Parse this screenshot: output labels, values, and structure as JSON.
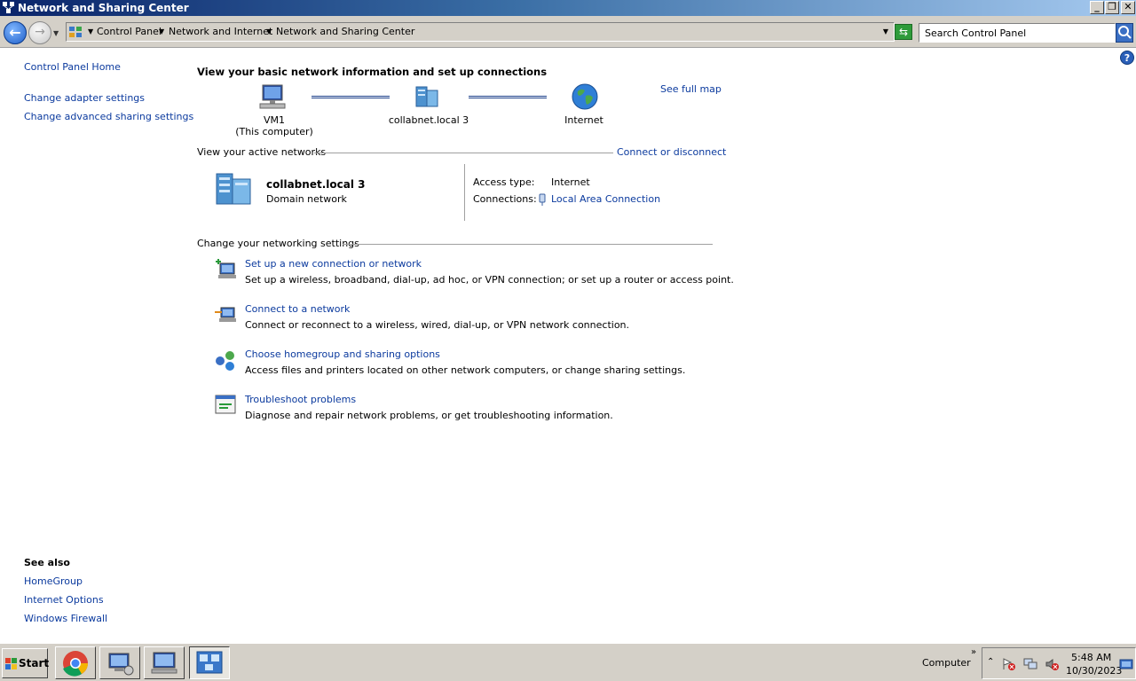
{
  "window": {
    "title": "Network and Sharing Center"
  },
  "address": {
    "crumbs": [
      "Control Panel",
      "Network and Internet",
      "Network and Sharing Center"
    ],
    "search_placeholder": "Search Control Panel"
  },
  "sidebar": {
    "home": "Control Panel Home",
    "links": [
      "Change adapter settings",
      "Change advanced sharing settings"
    ],
    "see_also_title": "See also",
    "see_also": [
      "HomeGroup",
      "Internet Options",
      "Windows Firewall"
    ]
  },
  "main": {
    "heading": "View your basic network information and set up connections",
    "see_full_map": "See full map",
    "map": {
      "computer_name": "VM1",
      "computer_sub": "(This computer)",
      "network_name": "collabnet.local  3",
      "internet": "Internet"
    },
    "active": {
      "title": "View your active networks",
      "connect_link": "Connect or disconnect",
      "network_name": "collabnet.local  3",
      "network_type": "Domain network",
      "access_label": "Access type:",
      "access_value": "Internet",
      "connections_label": "Connections:",
      "connections_value": "Local Area Connection"
    },
    "settings": {
      "title": "Change your networking settings",
      "tasks": [
        {
          "title": "Set up a new connection or network",
          "desc": "Set up a wireless, broadband, dial-up, ad hoc, or VPN connection; or set up a router or access point."
        },
        {
          "title": "Connect to a network",
          "desc": "Connect or reconnect to a wireless, wired, dial-up, or VPN network connection."
        },
        {
          "title": "Choose homegroup and sharing options",
          "desc": "Access files and printers located on other network computers, or change sharing settings."
        },
        {
          "title": "Troubleshoot problems",
          "desc": "Diagnose and repair network problems, or get troubleshooting information."
        }
      ]
    }
  },
  "taskbar": {
    "start": "Start",
    "computer": "Computer",
    "time": "5:48 AM",
    "date": "10/30/2023"
  },
  "colors": {
    "link": "#0b3a9e",
    "titlebar": "#0a246a"
  }
}
